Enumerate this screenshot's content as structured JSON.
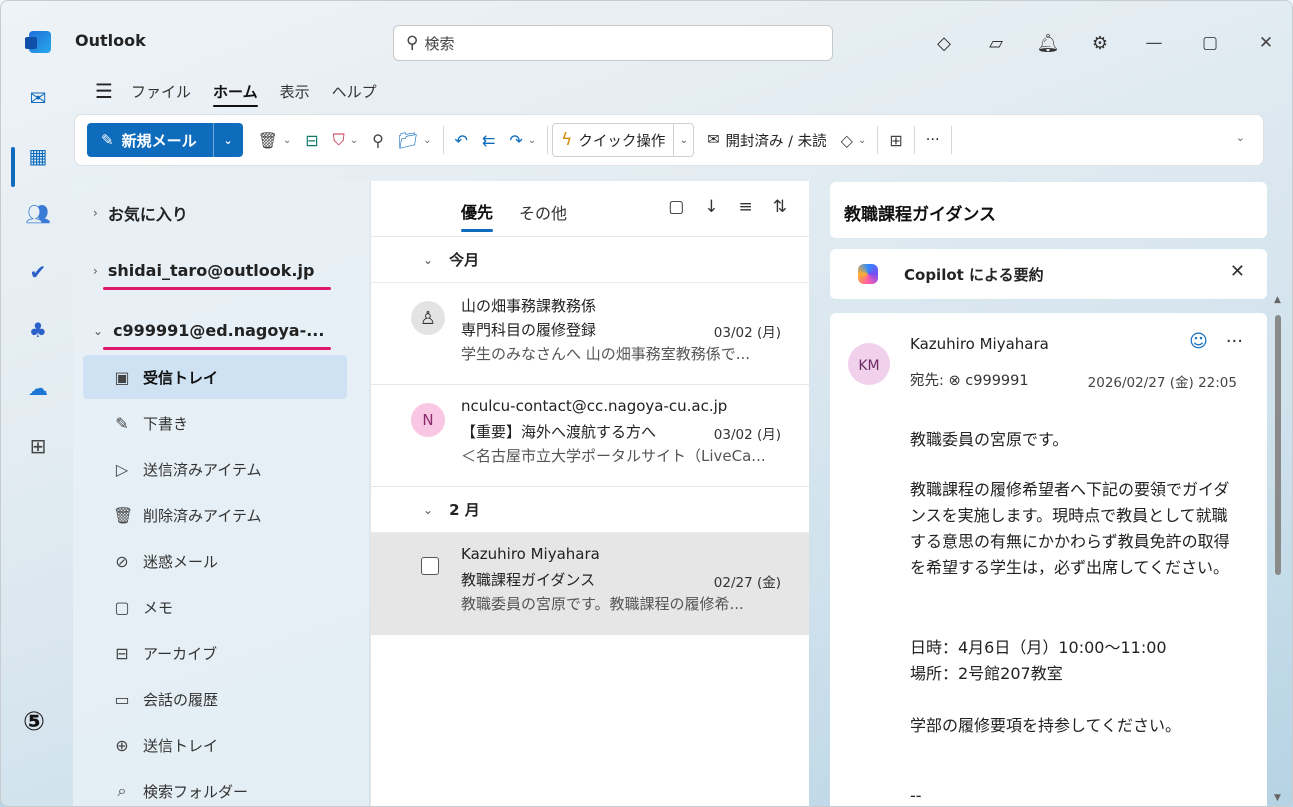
{
  "app": {
    "title": "Outlook"
  },
  "search": {
    "placeholder": "検索",
    "icon": "search-icon"
  },
  "titlebar_icons": [
    "premium-icon",
    "notes-icon",
    "bell-icon",
    "gear-icon"
  ],
  "menu": {
    "items": [
      "ファイル",
      "ホーム",
      "表示",
      "ヘルプ"
    ],
    "active": "ホーム"
  },
  "ribbon": {
    "new_mail": "新規メール",
    "quick_steps": "クイック操作",
    "mark_read": "開封済み / 未読",
    "more": "···"
  },
  "folders": {
    "favorites": "お気に入り",
    "accounts": [
      "shidai_taro@outlook.jp",
      "c999991@ed.nagoya-..."
    ],
    "items": [
      {
        "label": "受信トレイ",
        "icon": "inbox-icon",
        "selected": true
      },
      {
        "label": "下書き",
        "icon": "pencil-icon"
      },
      {
        "label": "送信済みアイテム",
        "icon": "send-icon"
      },
      {
        "label": "削除済みアイテム",
        "icon": "trash-icon"
      },
      {
        "label": "迷惑メール",
        "icon": "junk-icon"
      },
      {
        "label": "メモ",
        "icon": "note-icon"
      },
      {
        "label": "アーカイブ",
        "icon": "archive-icon"
      },
      {
        "label": "会話の履歴",
        "icon": "folder-icon"
      },
      {
        "label": "送信トレイ",
        "icon": "outbox-icon"
      },
      {
        "label": "検索フォルダー",
        "icon": "search-folder-icon"
      }
    ],
    "annotation": "⑤"
  },
  "message_list": {
    "tab_focused": "優先",
    "tab_other": "その他",
    "groups": [
      {
        "label": "今月"
      },
      {
        "label": "2 月"
      }
    ],
    "messages": [
      {
        "sender": "山の畑事務課教務係",
        "subject": "専門科目の履修登録",
        "date": "03/02 (月)",
        "preview": "学生のみなさんへ 山の畑事務室教務係で..."
      },
      {
        "sender": "nculcu-contact@cc.nagoya-cu.ac.jp",
        "subject": "【重要】海外へ渡航する方へ",
        "date": "03/02 (月)",
        "preview": "＜名古屋市立大学ポータルサイト（LiveCa...",
        "avatar": "N"
      },
      {
        "sender": "Kazuhiro Miyahara",
        "subject": "教職課程ガイダンス",
        "date": "02/27 (金)",
        "preview": "教職委員の宮原です。教職課程の履修希..."
      }
    ]
  },
  "reading": {
    "subject": "教職課程ガイダンス",
    "copilot": "Copilot による要約",
    "initials": "KM",
    "from": "Kazuhiro Miyahara",
    "to_label": "宛先:",
    "to": "c999991",
    "sent": "2026/02/27 (金) 22:05",
    "body": [
      "教職委員の宮原です。",
      "教職課程の履修希望者へ下記の要領でガイダンスを実施します。現時点で教員として就職する意思の有無にかかわらず教員免許の取得を希望する学生は，必ず出席してください。",
      "日時：4月6日（月）10:00～11:00",
      "場所：2号館207教室",
      "学部の履修要項を持参してください。",
      "--"
    ]
  },
  "colors": {
    "accent": "#0f6cbd",
    "underline": "#e0186c"
  }
}
